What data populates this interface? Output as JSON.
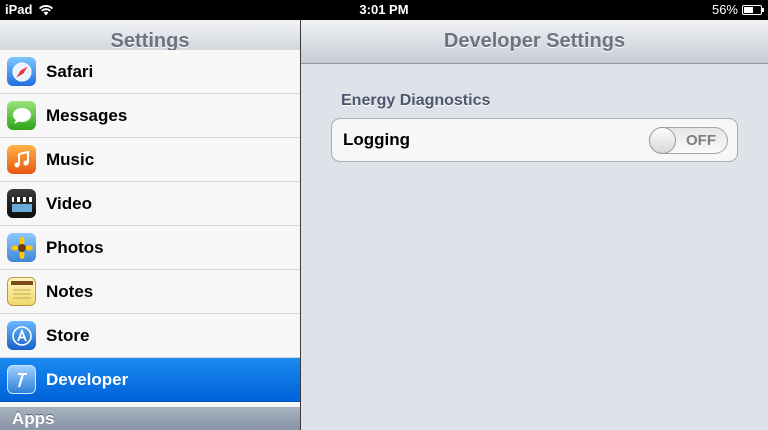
{
  "status_bar": {
    "device": "iPad",
    "time": "3:01 PM",
    "battery_percent": "56%",
    "battery_level": 0.56
  },
  "left_pane": {
    "title": "Settings",
    "items": [
      {
        "label": "Safari",
        "icon": "safari-icon"
      },
      {
        "label": "Messages",
        "icon": "messages-icon"
      },
      {
        "label": "Music",
        "icon": "music-icon"
      },
      {
        "label": "Video",
        "icon": "video-icon"
      },
      {
        "label": "Photos",
        "icon": "photos-icon"
      },
      {
        "label": "Notes",
        "icon": "notes-icon"
      },
      {
        "label": "Store",
        "icon": "store-icon"
      },
      {
        "label": "Developer",
        "icon": "developer-icon",
        "selected": true
      }
    ],
    "section_header": "Apps"
  },
  "right_pane": {
    "title": "Developer Settings",
    "group_title": "Energy Diagnostics",
    "logging": {
      "label": "Logging",
      "state": "OFF"
    }
  },
  "colors": {
    "selection": "#0a78e8",
    "section_header": "#97a3b3",
    "background": "#dfe2e8"
  }
}
